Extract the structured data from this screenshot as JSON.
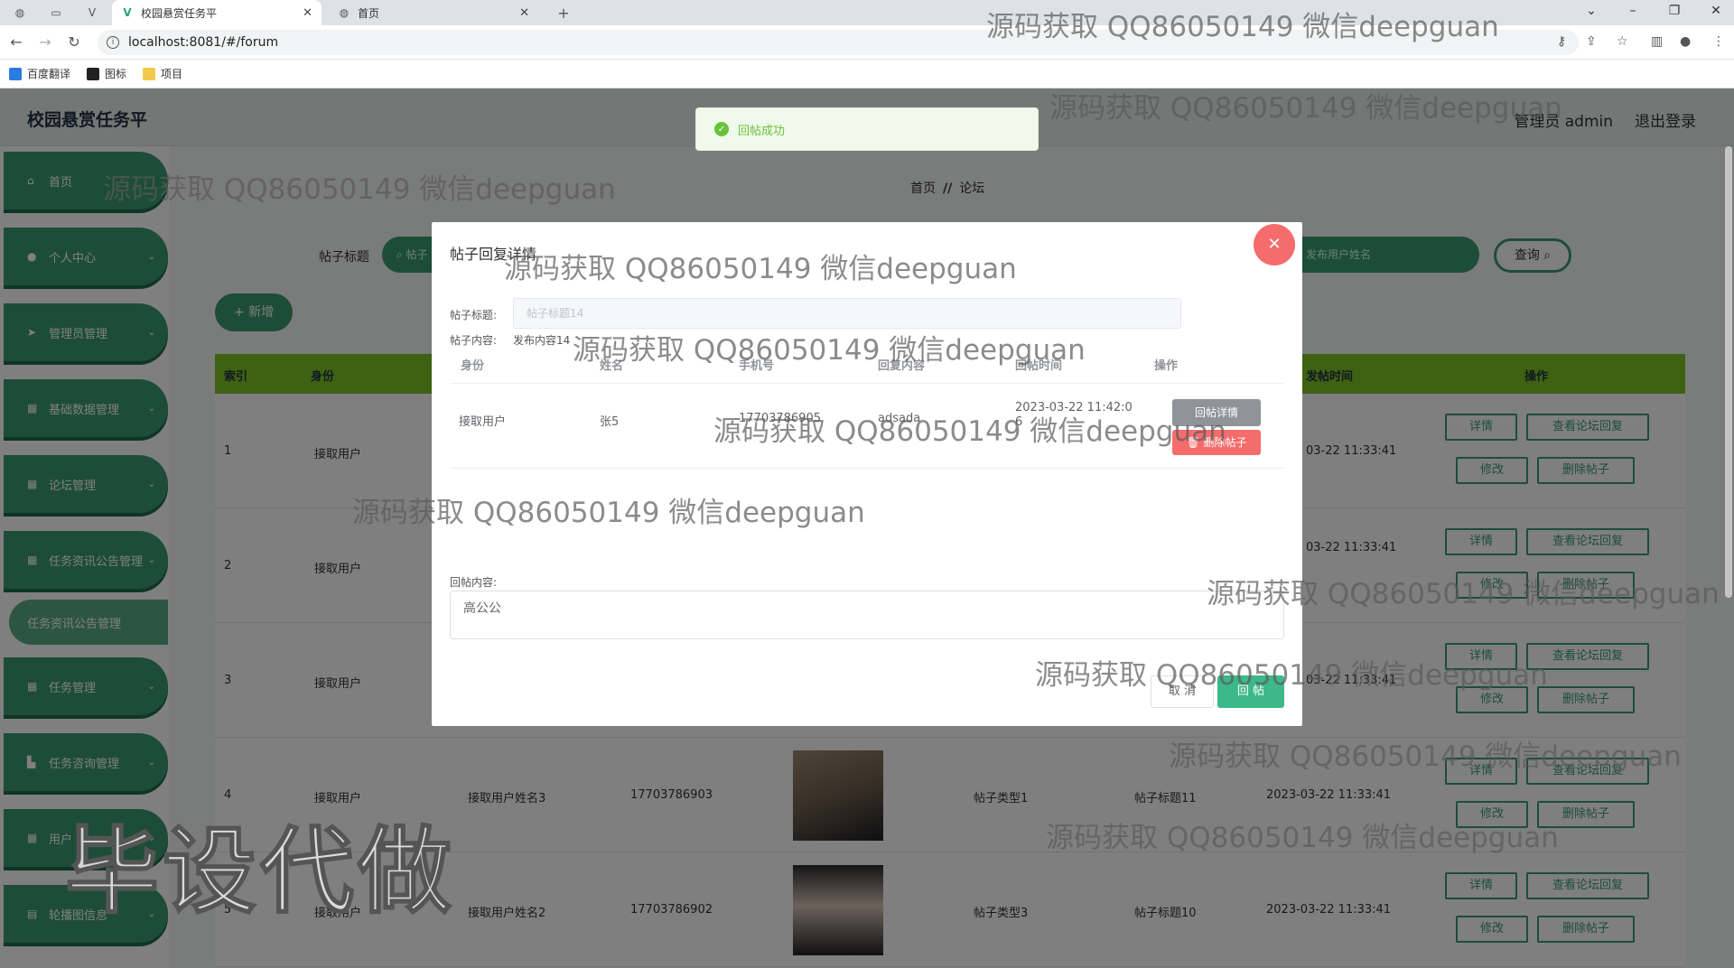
{
  "browser": {
    "tabs": [
      {
        "title": "校园悬赏任务平",
        "active": true
      },
      {
        "title": "首页",
        "active": false
      }
    ],
    "url": "localhost:8081/#/forum",
    "bookmarks": [
      "百度翻译",
      "图标",
      "项目"
    ]
  },
  "app": {
    "title": "校园悬赏任务平",
    "user_label": "管理员 admin",
    "logout_label": "退出登录"
  },
  "sidebar": {
    "items": [
      {
        "label": "首页",
        "icon": "home-icon"
      },
      {
        "label": "个人中心",
        "icon": "user-icon"
      },
      {
        "label": "管理员管理",
        "icon": "send-icon"
      },
      {
        "label": "基础数据管理",
        "icon": "grid-icon"
      },
      {
        "label": "论坛管理",
        "icon": "grid-icon"
      },
      {
        "label": "任务资讯公告管理",
        "icon": "grid-icon"
      },
      {
        "label": "任务管理",
        "icon": "grid-icon"
      },
      {
        "label": "任务咨询管理",
        "icon": "chart-icon"
      },
      {
        "label": "用户",
        "icon": "grid-icon"
      },
      {
        "label": "轮播图信息",
        "icon": "doc-icon"
      }
    ],
    "sub_item": "任务资讯公告管理"
  },
  "breadcrumb": {
    "home": "首页",
    "current": "论坛"
  },
  "search": {
    "label": "帖子标题",
    "placeholder": "帖子",
    "placeholder2": "发布用户姓名",
    "query_label": "查询",
    "add_label": "+ 新增"
  },
  "table": {
    "headers": [
      "索引",
      "身份",
      "发帖时间",
      "操作"
    ],
    "rows": [
      {
        "index": "1",
        "role": "接取用户",
        "name": "",
        "phone": "",
        "type": "",
        "title": "",
        "time": "03-22 11:33:41"
      },
      {
        "index": "2",
        "role": "接取用户",
        "name": "",
        "phone": "",
        "type": "",
        "title": "",
        "time": "03-22 11:33:41"
      },
      {
        "index": "3",
        "role": "接取用户",
        "name": "",
        "phone": "",
        "type": "",
        "title": "",
        "time": "03-22 11:33:41"
      },
      {
        "index": "4",
        "role": "接取用户",
        "name": "接取用户姓名3",
        "phone": "17703786903",
        "type": "帖子类型1",
        "title": "帖子标题11",
        "time": "2023-03-22 11:33:41"
      },
      {
        "index": "5",
        "role": "接取用户",
        "name": "接取用户姓名2",
        "phone": "17703786902",
        "type": "帖子类型3",
        "title": "帖子标题10",
        "time": "2023-03-22 11:33:41"
      }
    ],
    "ops": {
      "detail": "详情",
      "view_reply": "查看论坛回复",
      "edit": "修改",
      "delete": "删除帖子"
    }
  },
  "toast": {
    "message": "回帖成功"
  },
  "dialog": {
    "title": "帖子回复详情",
    "title_label": "帖子标题:",
    "title_value": "帖子标题14",
    "content_label": "帖子内容:",
    "content_value": "发布内容14",
    "reply_headers": [
      "身份",
      "姓名",
      "手机号",
      "回复内容",
      "回帖时间",
      "操作"
    ],
    "reply_row": {
      "role": "接取用户",
      "name": "张5",
      "phone": "17703786905",
      "content": "adsada",
      "time": "2023-03-22 11:42:0",
      "time2": "6"
    },
    "detail_btn": "回帖详情",
    "delete_btn": "删除帖子",
    "reply_label": "回帖内容:",
    "reply_value": "高公公",
    "cancel_btn": "取 消",
    "submit_btn": "回 帖"
  },
  "watermarks": {
    "text": "源码获取 QQ86050149 微信deepguan",
    "big": "毕设代做"
  }
}
